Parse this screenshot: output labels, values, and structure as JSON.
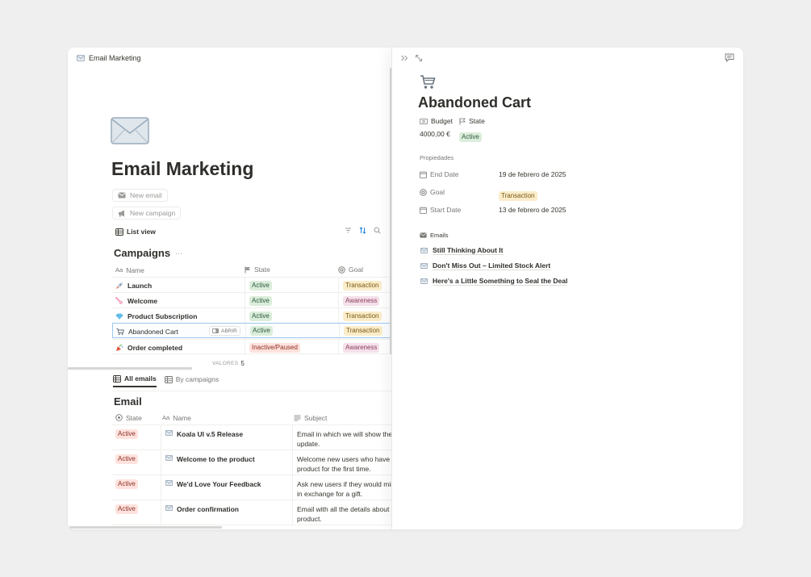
{
  "breadcrumb": {
    "title": "Email Marketing",
    "icon": "envelope-icon"
  },
  "page": {
    "title": "Email Marketing",
    "icon": "envelope-icon"
  },
  "buttons": {
    "new_email": "New email",
    "new_campaign": "New campaign"
  },
  "campaigns_view": {
    "view_label": "List view",
    "title": "Campaigns",
    "more": "···",
    "columns": {
      "name": "Name",
      "state": "State",
      "goal": "Goal"
    },
    "rows": [
      {
        "icon": "rocket-icon",
        "name": "Launch",
        "state": "Active",
        "goal": "Transaction"
      },
      {
        "icon": "comet-icon",
        "name": "Welcome",
        "state": "Active",
        "goal": "Awareness"
      },
      {
        "icon": "diamond-icon",
        "name": "Product Subscription",
        "state": "Active",
        "goal": "Transaction"
      },
      {
        "icon": "cart-icon",
        "name": "Abandoned Cart",
        "state": "Active",
        "goal": "Transaction",
        "open_label": "ABRIR"
      },
      {
        "icon": "party-popper-icon",
        "name": "Order completed",
        "state": "Inactive/Paused",
        "goal": "Awareness"
      }
    ],
    "footer": {
      "label": "VALORES",
      "count": "5"
    }
  },
  "emails_view": {
    "tabs": [
      "All emails",
      "By campaigns"
    ],
    "title": "Email",
    "columns": {
      "state": "State",
      "name": "Name",
      "subject": "Subject"
    },
    "rows": [
      {
        "state": "Active",
        "name": "Koala UI v.5 Release",
        "subject1": "Email in which we will show the me",
        "subject2": "update."
      },
      {
        "state": "Active",
        "name": "Welcome to the product",
        "subject1": "Welcome new users who have pur",
        "subject2": "product for the first time."
      },
      {
        "state": "Active",
        "name": "We'd Love Your Feedback",
        "subject1": "Ask new users if they would mind",
        "subject2": "in exchange for a gift."
      },
      {
        "state": "Active",
        "name": "Order confirmation",
        "subject1": "Email with all the details about the",
        "subject2": "product."
      }
    ]
  },
  "side_peek": {
    "icon": "shopping-cart-icon",
    "title": "Abandoned Cart",
    "budget_label": "Budget",
    "budget_value": "4000,00 €",
    "state_label": "State",
    "state_value": "Active",
    "properties_heading": "Propiedades",
    "properties": [
      {
        "icon": "calendar-icon",
        "label": "End Date",
        "value": "19 de febrero de 2025"
      },
      {
        "icon": "target-icon",
        "label": "Goal",
        "value": "Transaction"
      },
      {
        "icon": "calendar-icon",
        "label": "Start Date",
        "value": "13 de febrero de 2025"
      }
    ],
    "emails_heading": "Emails",
    "emails": [
      "Still Thinking About It",
      "Don't Miss Out – Limited Stock Alert",
      "Here's a Little Something to Seal the Deal"
    ]
  },
  "colors": {
    "green_bg": "#dbeddb",
    "green_fg": "#2b593f",
    "yellow_bg": "#fbecc9",
    "yellow_fg": "#7a5a17",
    "pink_bg": "#f5e0e9",
    "pink_fg": "#8a3f61",
    "red_bg": "#ffe2dd",
    "red_fg": "#8a2f24"
  }
}
